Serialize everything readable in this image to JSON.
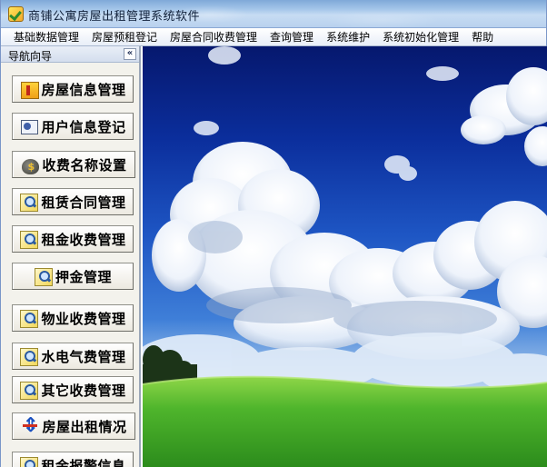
{
  "window": {
    "title": "商铺公寓房屋出租管理系统软件"
  },
  "menu": {
    "items": [
      "基础数据管理",
      "房屋预租登记",
      "房屋合同收费管理",
      "查询管理",
      "系统维护",
      "系统初始化管理",
      "帮助"
    ]
  },
  "nav": {
    "title": "导航向导",
    "collapse_label": "«",
    "items": [
      {
        "label": "房屋信息管理",
        "icon": "house-icon"
      },
      {
        "label": "用户信息登记",
        "icon": "user-card-icon"
      },
      {
        "label": "收费名称设置",
        "icon": "money-bag-icon"
      },
      {
        "label": "租赁合同管理",
        "icon": "search-document-icon"
      },
      {
        "label": "租金收费管理",
        "icon": "search-document-icon"
      },
      {
        "label": "押金管理",
        "icon": "search-document-icon"
      },
      {
        "label": "物业收费管理",
        "icon": "search-document-icon"
      },
      {
        "label": "水电气费管理",
        "icon": "search-document-icon"
      },
      {
        "label": "其它收费管理",
        "icon": "search-document-icon"
      },
      {
        "label": "房屋出租情况",
        "icon": "arrows-icon"
      },
      {
        "label": "租金报警信息",
        "icon": "search-document-icon"
      }
    ]
  },
  "colors": {
    "sky_top": "#06186e",
    "sky_mid": "#1e56c4",
    "grass": "#3fae2a",
    "nav_bg": "#f3f2ec"
  }
}
